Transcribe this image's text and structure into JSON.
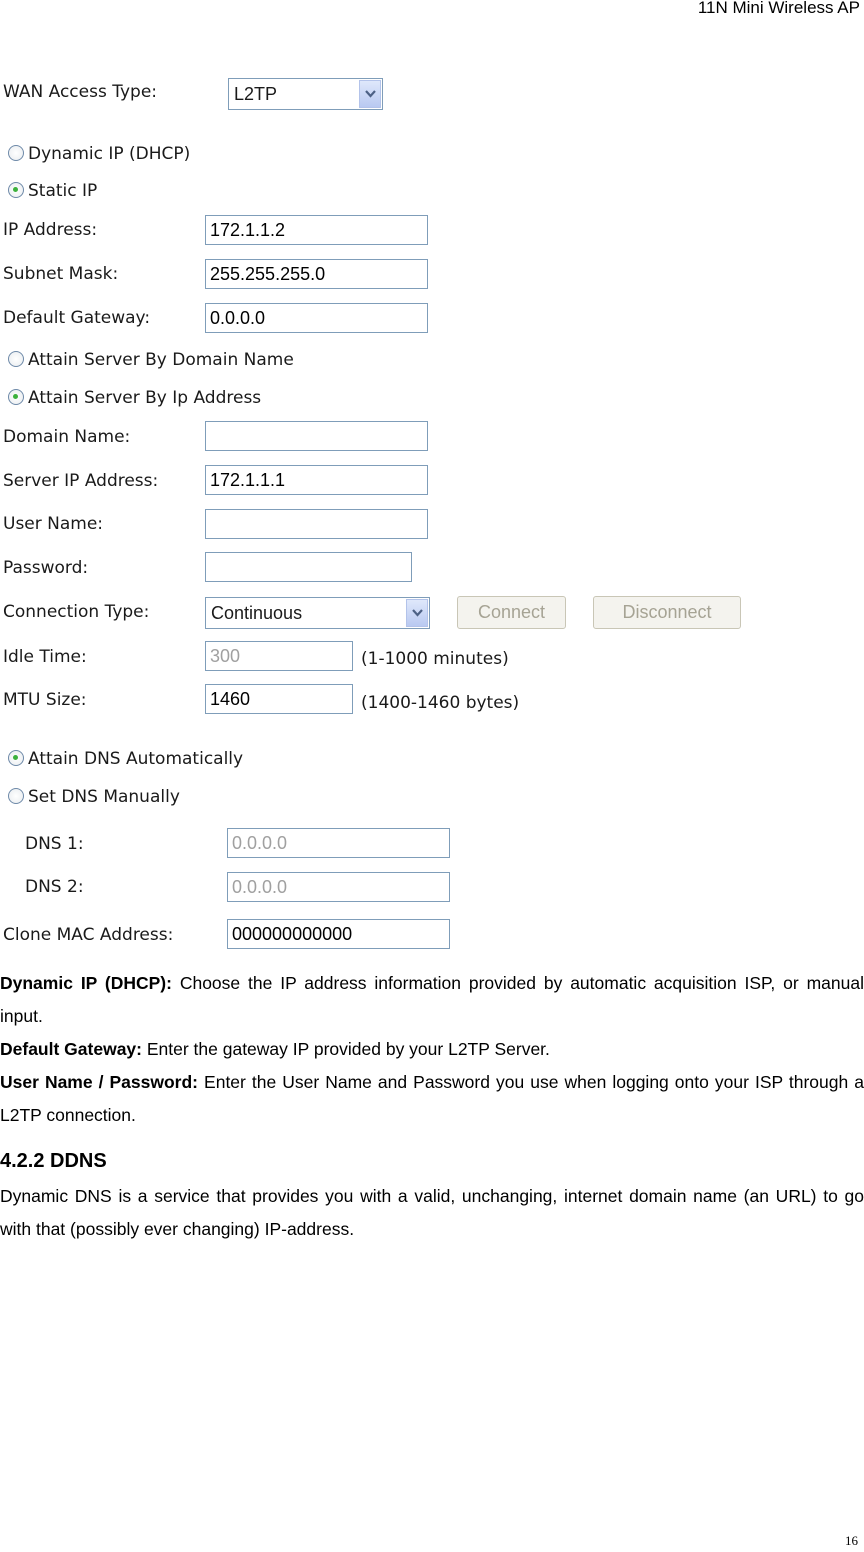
{
  "page": {
    "header": "11N Mini Wireless AP",
    "page_number": "16"
  },
  "form": {
    "wan_access_type": {
      "label": "WAN Access Type:",
      "value": "L2TP"
    },
    "ip_mode": [
      {
        "label": "Dynamic IP (DHCP)",
        "selected": false
      },
      {
        "label": "Static IP",
        "selected": true
      }
    ],
    "ip_address": {
      "label": "IP Address:",
      "value": "172.1.1.2"
    },
    "subnet_mask": {
      "label": "Subnet Mask:",
      "value": "255.255.255.0"
    },
    "default_gateway": {
      "label": "Default Gateway:",
      "value": "0.0.0.0"
    },
    "server_mode": [
      {
        "label": "Attain Server By Domain Name",
        "selected": false
      },
      {
        "label": "Attain Server By Ip Address",
        "selected": true
      }
    ],
    "domain_name": {
      "label": "Domain Name:",
      "value": ""
    },
    "server_ip": {
      "label": "Server IP Address:",
      "value": "172.1.1.1"
    },
    "user_name": {
      "label": "User Name:",
      "value": ""
    },
    "password": {
      "label": "Password:",
      "value": ""
    },
    "connection_type": {
      "label": "Connection Type:",
      "value": "Continuous"
    },
    "connect_button": "Connect",
    "disconnect_button": "Disconnect",
    "idle_time": {
      "label": "Idle Time:",
      "value": "300",
      "hint": "(1-1000 minutes)"
    },
    "mtu_size": {
      "label": "MTU Size:",
      "value": "1460",
      "hint": "(1400-1460 bytes)"
    },
    "dns_mode": [
      {
        "label": "Attain DNS Automatically",
        "selected": true
      },
      {
        "label": "Set DNS Manually",
        "selected": false
      }
    ],
    "dns1": {
      "label": "DNS 1:",
      "value": "0.0.0.0"
    },
    "dns2": {
      "label": "DNS 2:",
      "value": "0.0.0.0"
    },
    "clone_mac": {
      "label": "Clone MAC Address:",
      "value": "000000000000"
    }
  },
  "doc": {
    "para1_bold": "Dynamic IP (DHCP):",
    "para1_text": " Choose the IP address information provided by automatic acquisition ISP, or manual input.",
    "para2_bold": "Default Gateway:",
    "para2_text": " Enter the gateway IP provided by your L2TP Server.",
    "para3_bold": "User Name / Password:",
    "para3_text": " Enter the User Name and Password you use when logging onto your ISP through a L2TP connection.",
    "section_heading": "4.2.2 DDNS",
    "section_text": "Dynamic DNS is a service that provides you with a valid, unchanging, internet domain name (an URL) to go with that (possibly ever changing) IP-address."
  }
}
